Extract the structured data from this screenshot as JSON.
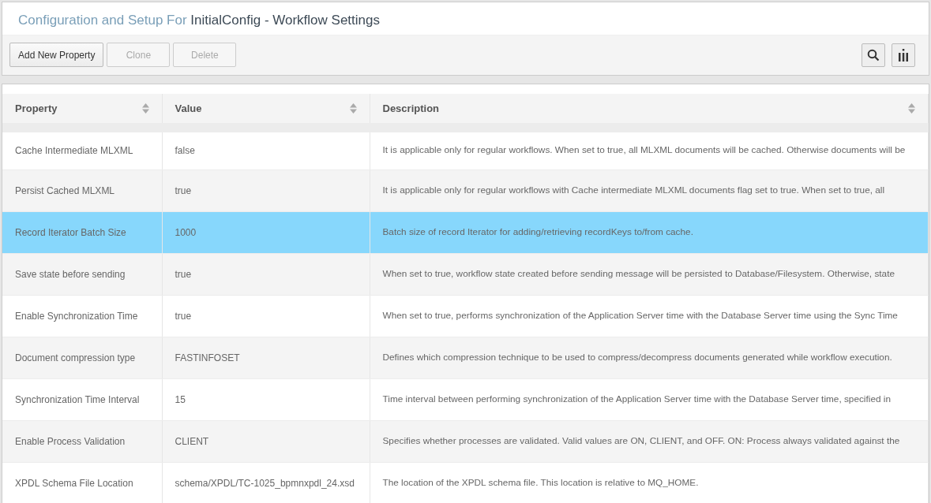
{
  "header": {
    "prefix": "Configuration and Setup For",
    "title": "InitialConfig - Workflow Settings"
  },
  "toolbar": {
    "buttons": [
      {
        "label": "Add New Property",
        "disabled": false
      },
      {
        "label": "Clone",
        "disabled": true
      },
      {
        "label": "Delete",
        "disabled": true
      }
    ]
  },
  "table": {
    "columns": [
      "Property",
      "Value",
      "Description"
    ],
    "rows": [
      {
        "property": "Cache Intermediate MLXML",
        "value": "false",
        "description": "It is applicable only for regular workflows. When set to true, all MLXML documents will be cached. Otherwise documents will be",
        "selected": false
      },
      {
        "property": "Persist Cached MLXML",
        "value": "true",
        "description": "It is applicable only for regular workflows with Cache intermediate MLXML documents flag set to true. When set to true, all",
        "selected": false
      },
      {
        "property": "Record Iterator Batch Size",
        "value": "1000",
        "description": "Batch size of record Iterator for adding/retrieving recordKeys to/from cache.",
        "selected": true
      },
      {
        "property": "Save state before sending",
        "value": "true",
        "description": "When set to true, workflow state created before sending message will be persisted to Database/Filesystem. Otherwise, state",
        "selected": false
      },
      {
        "property": "Enable Synchronization Time",
        "value": "true",
        "description": "When set to true, performs synchronization of the Application Server time with the Database Server time using the Sync Time",
        "selected": false
      },
      {
        "property": "Document compression type",
        "value": "FASTINFOSET",
        "description": "Defines which compression technique to be used to compress/decompress documents generated while workflow execution.",
        "selected": false
      },
      {
        "property": "Synchronization Time Interval",
        "value": "15",
        "description": "Time interval between performing synchronization of the Application Server time with the Database Server time, specified in",
        "selected": false
      },
      {
        "property": "Enable Process Validation",
        "value": "CLIENT",
        "description": "Specifies whether processes are validated. Valid values are ON, CLIENT, and OFF. ON: Process always validated against the",
        "selected": false
      },
      {
        "property": "XPDL Schema File Location",
        "value": "schema/XPDL/TC-1025_bpmnxpdl_24.xsd",
        "description": "The location of the XPDL schema file. This location is relative to MQ_HOME.",
        "selected": false
      }
    ]
  }
}
